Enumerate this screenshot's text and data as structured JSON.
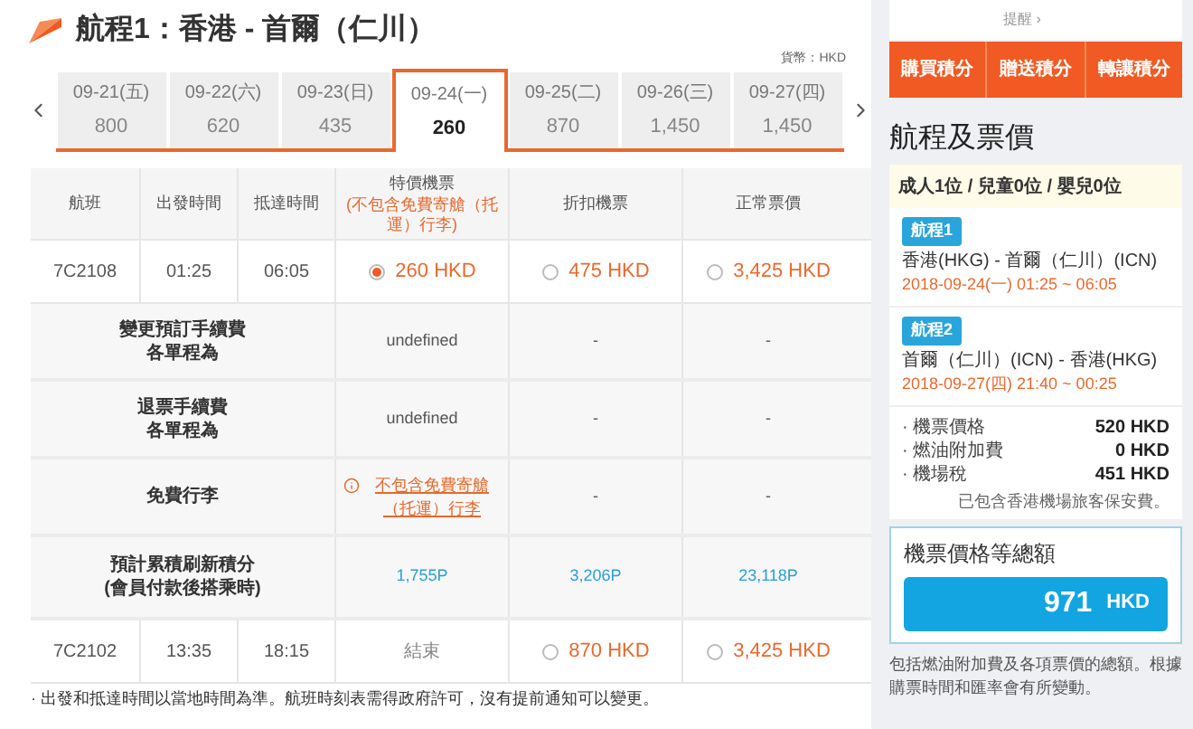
{
  "segment": {
    "title": "航程1：香港 - 首爾（仁川）",
    "currency": "貨幣：HKD"
  },
  "dates": [
    {
      "date": "09-21(五)",
      "price": "800",
      "selected": false
    },
    {
      "date": "09-22(六)",
      "price": "620",
      "selected": false
    },
    {
      "date": "09-23(日)",
      "price": "435",
      "selected": false
    },
    {
      "date": "09-24(一)",
      "price": "260",
      "selected": true
    },
    {
      "date": "09-25(二)",
      "price": "870",
      "selected": false
    },
    {
      "date": "09-26(三)",
      "price": "1,450",
      "selected": false
    },
    {
      "date": "09-27(四)",
      "price": "1,450",
      "selected": false
    }
  ],
  "table": {
    "columns": [
      {
        "label": "航班"
      },
      {
        "label": "出發時間"
      },
      {
        "label": "抵達時間"
      },
      {
        "label": "特價機票",
        "note": "(不包含免費寄艙（托運）行李)"
      },
      {
        "label": "折扣機票"
      },
      {
        "label": "正常票價"
      }
    ],
    "flights": [
      {
        "flight": "7C2108",
        "departs": "01:25",
        "arrives": "06:05",
        "fares": [
          {
            "kind": "radio",
            "text": "260 HKD",
            "selected": true
          },
          {
            "kind": "radio",
            "text": "475 HKD",
            "selected": false
          },
          {
            "kind": "radio",
            "text": "3,425 HKD",
            "selected": false
          }
        ],
        "details": [
          {
            "label": [
              "變更預訂手續費",
              "各單程為"
            ],
            "cells": [
              {
                "kind": "text",
                "text": "undefined"
              },
              {
                "kind": "text",
                "text": "-"
              },
              {
                "kind": "text",
                "text": "-"
              }
            ]
          },
          {
            "label": [
              "退票手續費",
              "各單程為"
            ],
            "cells": [
              {
                "kind": "text",
                "text": "undefined"
              },
              {
                "kind": "text",
                "text": "-"
              },
              {
                "kind": "text",
                "text": "-"
              }
            ]
          },
          {
            "label": [
              "免費行李"
            ],
            "cells": [
              {
                "kind": "warning",
                "text": "不包含免費寄艙（托運）行李"
              },
              {
                "kind": "text",
                "text": "-"
              },
              {
                "kind": "text",
                "text": "-"
              }
            ]
          },
          {
            "label": [
              "預計累積刷新積分",
              "(會員付款後搭乘時)"
            ],
            "cells": [
              {
                "kind": "points",
                "text": "1,755P"
              },
              {
                "kind": "points",
                "text": "3,206P"
              },
              {
                "kind": "points",
                "text": "23,118P"
              }
            ]
          }
        ]
      },
      {
        "flight": "7C2102",
        "departs": "13:35",
        "arrives": "18:15",
        "fares": [
          {
            "kind": "text",
            "text": "結束"
          },
          {
            "kind": "radio",
            "text": "870 HKD",
            "selected": false
          },
          {
            "kind": "radio",
            "text": "3,425 HKD",
            "selected": false
          }
        ]
      }
    ],
    "footnote": "· 出發和抵達時間以當地時間為準。航班時刻表需得政府許可，沒有提前通知可以變更。"
  },
  "sidebar": {
    "reminder": "提醒 ›",
    "points_buttons": [
      "購買積分",
      "贈送積分",
      "轉讓積分"
    ],
    "summary": {
      "title": "航程及票價",
      "passengers": "成人1位 / 兒童0位 / 嬰兒0位",
      "legs": [
        {
          "badge": "航程1",
          "route": "香港(HKG) - 首爾（仁川）(ICN)",
          "time": "2018-09-24(一) 01:25 ~ 06:05"
        },
        {
          "badge": "航程2",
          "route": "首爾（仁川）(ICN) - 香港(HKG)",
          "time": "2018-09-27(四) 21:40 ~ 00:25"
        }
      ],
      "charges": [
        {
          "label": "· 機票價格",
          "amount": "520 HKD"
        },
        {
          "label": "· 燃油附加費",
          "amount": "0 HKD"
        },
        {
          "label": "· 機場稅",
          "amount": "451 HKD"
        }
      ],
      "charges_note": "已包含香港機場旅客保安費。",
      "total": {
        "label": "機票價格等總額",
        "amount": "971",
        "currency": "HKD"
      },
      "note": "包括燃油附加費及各項票價的總額。根據購票時間和匯率會有所變動。"
    }
  }
}
